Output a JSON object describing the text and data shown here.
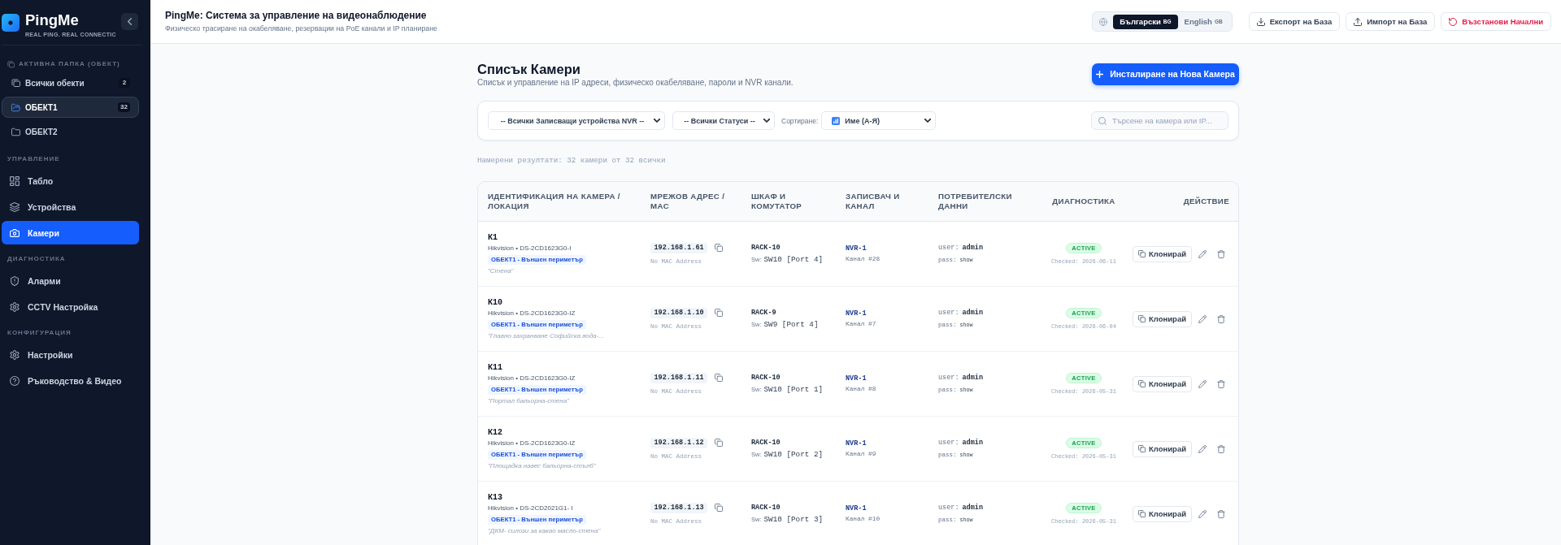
{
  "sidebar": {
    "logo": {
      "name": "PingMe",
      "tagline": "REAL PING. REAL CONNECTIC"
    },
    "folder_section": {
      "title": "АКТИВНА ПАПКА (ОБЕКТ)",
      "items": [
        {
          "label": "Всички обекти",
          "count": "2",
          "selected": false
        },
        {
          "label": "ОБЕКТ1",
          "count": "32",
          "selected": true
        },
        {
          "label": "ОБЕКТ2",
          "selected": false
        }
      ]
    },
    "nav_sections": [
      {
        "title": "УПРАВЛЕНИЕ",
        "items": [
          {
            "label": "Табло",
            "selected": false
          },
          {
            "label": "Устройства",
            "selected": false
          },
          {
            "label": "Камери",
            "selected": true
          }
        ]
      },
      {
        "title": "ДИАГНОСТИКА",
        "items": [
          {
            "label": "Аларми",
            "selected": false
          },
          {
            "label": "CCTV Настройка",
            "selected": false
          }
        ]
      },
      {
        "title": "КОНФИГУРАЦИЯ",
        "items": [
          {
            "label": "Настройки",
            "selected": false
          },
          {
            "label": "Ръководство & Видео",
            "selected": false
          }
        ]
      }
    ]
  },
  "header": {
    "title": "PingMe: Система за управление на видеонаблюдение",
    "subtitle": "Физическо трасиране на окабеляване, резервации на PoE канали и IP планиране",
    "languages": [
      {
        "label": "Български",
        "code": "BG",
        "selected": true
      },
      {
        "label": "English",
        "code": "GB",
        "selected": false
      }
    ],
    "actions": [
      {
        "label": "Експорт на База",
        "kind": "export"
      },
      {
        "label": "Импорт на База",
        "kind": "import"
      },
      {
        "label": "Възстанови Начални",
        "kind": "reset"
      }
    ]
  },
  "page": {
    "title": "Списък Камери",
    "subtitle": "Списък и управление на IP адреси, физическо окабеляване, пароли и NVR канали.",
    "primary_action": "Инсталиране на Нова Камера"
  },
  "filters": {
    "nvr": "-- Всички Записващи устройства NVR --",
    "status": "-- Всички Статуси --",
    "sort_label": "Сортиране:",
    "sort": "Име (А-Я)",
    "search": {
      "placeholder": "Търсене на камера или IP..."
    }
  },
  "results": "Намерени резултати: 32 камери от 32 всички",
  "table": {
    "columns": [
      "ИДЕНТИФИКАЦИЯ НА КАМЕРА / ЛОКАЦИЯ",
      "МРЕЖОВ АДРЕС / MAC",
      "ШКАФ И КОМУТАТОР",
      "ЗАПИСВАЧ И КАНАЛ",
      "ПОТРЕБИТЕЛСКИ ДАННИ",
      "ДИАГНОСТИКА",
      "ДЕЙСТВИЕ"
    ],
    "rows": [
      {
        "name": "К1",
        "vendor_model": "Hikvision • DS-2CD1623G0-I",
        "location": "ОБЕКТ1 - Външен периметър",
        "note": "\"Стена\"",
        "ip": "192.168.1.61",
        "mac": "No MAC Address",
        "rack": "RACK-10",
        "switch_label": "Sw:",
        "switch_port": "SW10 [Port 4]",
        "nvr": "NVR-1",
        "channel": "Канал #28",
        "user_label": "user:",
        "user": "admin",
        "pass_label": "pass:",
        "pass": "show",
        "status": "ACTIVE",
        "last_check": "Checked: 2026-06-11",
        "action": "Клонирай"
      },
      {
        "name": "К10",
        "vendor_model": "Hikvision • DS-2CD1623G0-IZ",
        "location": "ОБЕКТ1 - Външен периметър",
        "note": "\"Главно захранване Софийска вода-...",
        "ip": "192.168.1.10",
        "mac": "No MAC Address",
        "rack": "RACK-9",
        "switch_label": "Sw:",
        "switch_port": "SW9 [Port 4]",
        "nvr": "NVR-1",
        "channel": "Канал #7",
        "user_label": "user:",
        "user": "admin",
        "pass_label": "pass:",
        "pass": "show",
        "status": "ACTIVE",
        "last_check": "Checked: 2026-06-04",
        "action": "Клонирай"
      },
      {
        "name": "К11",
        "vendor_model": "Hikvision • DS-2CD1623G0-IZ",
        "location": "ОБЕКТ1 - Външен периметър",
        "note": "\"Портал бальорна-стена\"",
        "ip": "192.168.1.11",
        "mac": "No MAC Address",
        "rack": "RACK-10",
        "switch_label": "Sw:",
        "switch_port": "SW10 [Port 1]",
        "nvr": "NVR-1",
        "channel": "Канал #8",
        "user_label": "user:",
        "user": "admin",
        "pass_label": "pass:",
        "pass": "show",
        "status": "ACTIVE",
        "last_check": "Checked: 2026-05-31",
        "action": "Клонирай"
      },
      {
        "name": "К12",
        "vendor_model": "Hikvision • DS-2CD1623G0-IZ",
        "location": "ОБЕКТ1 - Външен периметър",
        "note": "\"Площадка навес бальорна-стълб\"",
        "ip": "192.168.1.12",
        "mac": "No MAC Address",
        "rack": "RACK-10",
        "switch_label": "Sw:",
        "switch_port": "SW10 [Port 2]",
        "nvr": "NVR-1",
        "channel": "Канал #9",
        "user_label": "user:",
        "user": "admin",
        "pass_label": "pass:",
        "pass": "show",
        "status": "ACTIVE",
        "last_check": "Checked: 2026-05-31",
        "action": "Клонирай"
      },
      {
        "name": "К13",
        "vendor_model": "Hikvision • DS-2CD2021G1- I",
        "location": "ОБЕКТ1 - Външен периметър",
        "note": "\"ДКМ- силози за какао масло-стена\"",
        "ip": "192.168.1.13",
        "mac": "No MAC Address",
        "rack": "RACK-10",
        "switch_label": "Sw:",
        "switch_port": "SW10 [Port 3]",
        "nvr": "NVR-1",
        "channel": "Канал #10",
        "user_label": "user:",
        "user": "admin",
        "pass_label": "pass:",
        "pass": "show",
        "status": "ACTIVE",
        "last_check": "Checked: 2026-05-31",
        "action": "Клонирай"
      }
    ]
  }
}
